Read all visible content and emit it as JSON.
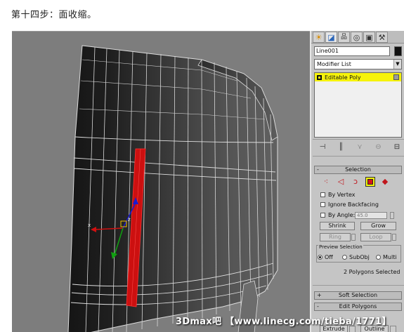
{
  "page": {
    "title": "第十四步：面收缩。",
    "watermark": "3Dmax吧 【www.linecg.com/tieba/1771】"
  },
  "panel": {
    "tabs": [
      {
        "icon": "sun-icon",
        "glyph": "☀"
      },
      {
        "icon": "modify-icon",
        "glyph": "◪"
      },
      {
        "icon": "hierarchy-icon",
        "glyph": "品"
      },
      {
        "icon": "motion-icon",
        "glyph": "◎"
      },
      {
        "icon": "display-icon",
        "glyph": "▣"
      },
      {
        "icon": "utilities-icon",
        "glyph": "⚒"
      }
    ],
    "object_name": "Line001",
    "object_color": "#111111",
    "modifier_list": "Modifier List",
    "stack_item": "Editable Poly",
    "stack_tools": {
      "pin_glyph": "⊣",
      "show_end_glyph": "║",
      "unique_glyph": "⋎",
      "remove_glyph": "⊖",
      "configure_glyph": "⊟"
    },
    "selection": {
      "header": "Selection",
      "collapse_sign": "-",
      "icons": [
        {
          "name": "vertex-icon",
          "glyph": "⁖"
        },
        {
          "name": "edge-icon",
          "glyph": "◁"
        },
        {
          "name": "border-icon",
          "glyph": "ↄ"
        },
        {
          "name": "polygon-icon",
          "glyph": ""
        },
        {
          "name": "element-icon",
          "glyph": "◆"
        }
      ],
      "by_vertex": "By Vertex",
      "ignore_backfacing": "Ignore Backfacing",
      "by_angle": "By Angle:",
      "angle_value": "45.0",
      "shrink": "Shrink",
      "grow": "Grow",
      "ring": "Ring",
      "loop": "Loop",
      "preview_label": "Preview Selection",
      "preview_off": "Off",
      "preview_subobj": "SubObj",
      "preview_multi": "Multi",
      "status": "2 Polygons Selected"
    },
    "soft_selection": {
      "header": "Soft Selection",
      "sign": "+"
    },
    "edit_polygons": {
      "header": "Edit Polygons",
      "sign": "-",
      "extrude": "Extrude",
      "outline": "Outline"
    }
  },
  "colors": {
    "viewport_bg": "#7d7d7d",
    "selected_faces": "#cc1010",
    "stack_highlight": "#f6f30c"
  }
}
